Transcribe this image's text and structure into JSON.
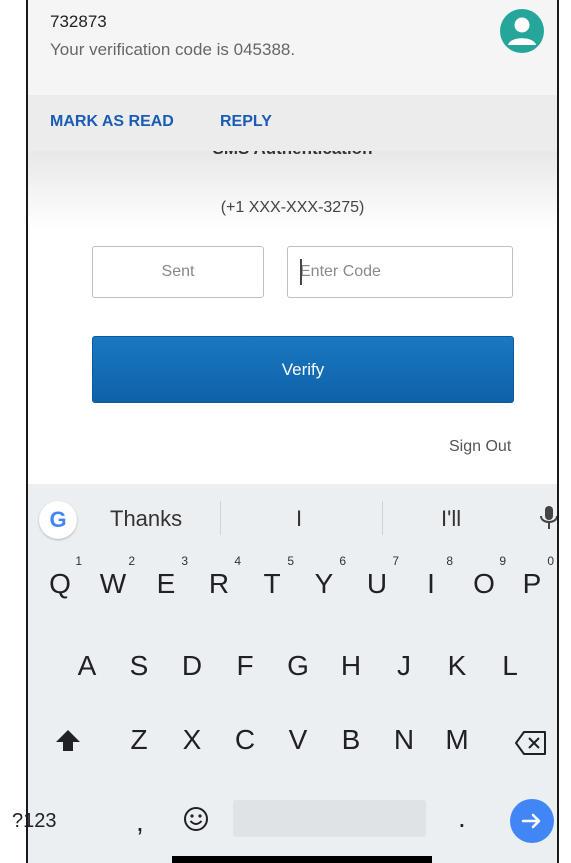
{
  "notification": {
    "sender": "732873",
    "message": "Your verification code is 045388.",
    "avatar_color": "#26a69a",
    "actions": {
      "mark_read": "MARK AS READ",
      "reply": "REPLY"
    }
  },
  "app": {
    "title": "SMS Authentication",
    "phone": "(+1 XXX-XXX-3275)",
    "sent_label": "Sent",
    "code_placeholder": "Enter Code",
    "code_value": "",
    "verify_label": "Verify",
    "sign_out_label": "Sign Out",
    "accent_color": "#1a6db5"
  },
  "keyboard": {
    "logo": "G",
    "suggestions": [
      "Thanks",
      "I",
      "I'll"
    ],
    "row1": [
      {
        "key": "Q",
        "hint": "1"
      },
      {
        "key": "W",
        "hint": "2"
      },
      {
        "key": "E",
        "hint": "3"
      },
      {
        "key": "R",
        "hint": "4"
      },
      {
        "key": "T",
        "hint": "5"
      },
      {
        "key": "Y",
        "hint": "6"
      },
      {
        "key": "U",
        "hint": "7"
      },
      {
        "key": "I",
        "hint": "8"
      },
      {
        "key": "O",
        "hint": "9"
      },
      {
        "key": "P",
        "hint": "0"
      }
    ],
    "row2": [
      "A",
      "S",
      "D",
      "F",
      "G",
      "H",
      "J",
      "K",
      "L"
    ],
    "row3": [
      "Z",
      "X",
      "C",
      "V",
      "B",
      "N",
      "M"
    ],
    "symbols_label": "?123",
    "comma_label": ",",
    "period_label": ".",
    "icons": {
      "mic": "microphone-icon",
      "shift": "shift-icon",
      "backspace": "backspace-icon",
      "emoji": "emoji-icon",
      "enter": "arrow-right-icon"
    },
    "enter_color": "#4285f4"
  }
}
